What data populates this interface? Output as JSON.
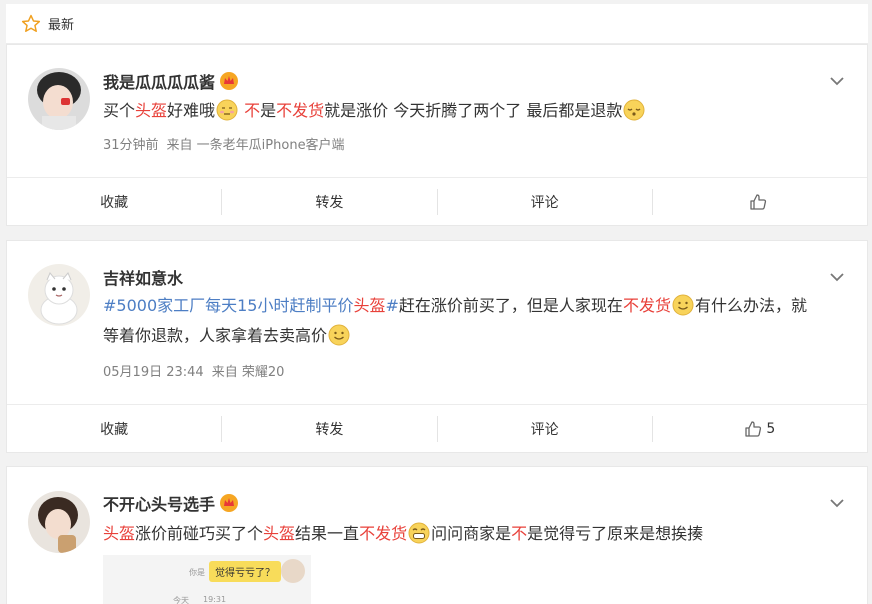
{
  "header": {
    "title": "最新",
    "icon": "star-icon"
  },
  "posts": [
    {
      "user": "我是瓜瓜瓜瓜酱",
      "verified_icon": "crown-badge-icon",
      "text": [
        {
          "t": "买个",
          "s": ""
        },
        {
          "t": "头盔",
          "s": "red"
        },
        {
          "t": "好难哦",
          "s": ""
        },
        {
          "e": "awkward-emoji"
        },
        {
          "t": " 不",
          "s": "red"
        },
        {
          "t": "是",
          "s": ""
        },
        {
          "t": "不发货",
          "s": "red"
        },
        {
          "t": "就是涨价 今天折腾了两个了 最后都是退款",
          "s": ""
        },
        {
          "e": "sleepy-emoji"
        }
      ],
      "time": "31分钟前",
      "source": "来自 一条老年瓜iPhone客户端",
      "actions": {
        "fav": "收藏",
        "repost": "转发",
        "comment": "评论",
        "likes": ""
      }
    },
    {
      "user": "吉祥如意水",
      "verified_icon": "",
      "text": [
        {
          "t": "#5000家工厂每天15小时赶制平价",
          "s": "topic"
        },
        {
          "t": "头盔",
          "s": "red"
        },
        {
          "t": "#",
          "s": "topic"
        },
        {
          "t": "赶在涨价前买了，但是人家现在",
          "s": ""
        },
        {
          "t": "不发货",
          "s": "red"
        },
        {
          "e": "smile-emoji"
        },
        {
          "t": "有什么办法，就等着你退款，人家拿着去卖高价",
          "s": ""
        },
        {
          "e": "smile-emoji"
        }
      ],
      "time": "05月19日 23:44",
      "source": "来自 荣耀20",
      "actions": {
        "fav": "收藏",
        "repost": "转发",
        "comment": "评论",
        "likes": "5"
      }
    },
    {
      "user": "不开心头号选手",
      "verified_icon": "crown-badge-icon",
      "text": [
        {
          "t": "头盔",
          "s": "red"
        },
        {
          "t": "涨价前碰巧买了个",
          "s": ""
        },
        {
          "t": "头盔",
          "s": "red"
        },
        {
          "t": "结果一直",
          "s": ""
        },
        {
          "t": "不发货",
          "s": "red"
        },
        {
          "e": "grin-emoji"
        },
        {
          "t": "问问商家是",
          "s": ""
        },
        {
          "t": "不",
          "s": "red"
        },
        {
          "t": "是觉得亏了原来是想挨揍",
          "s": ""
        }
      ],
      "image": {
        "bubble": "觉得亏亏了？",
        "label_1": "你是",
        "label_2": "今天",
        "time": "19:31"
      }
    }
  ],
  "colors": {
    "keyword": "#e8413a",
    "topic": "#4d7ec4",
    "meta": "#808080"
  }
}
